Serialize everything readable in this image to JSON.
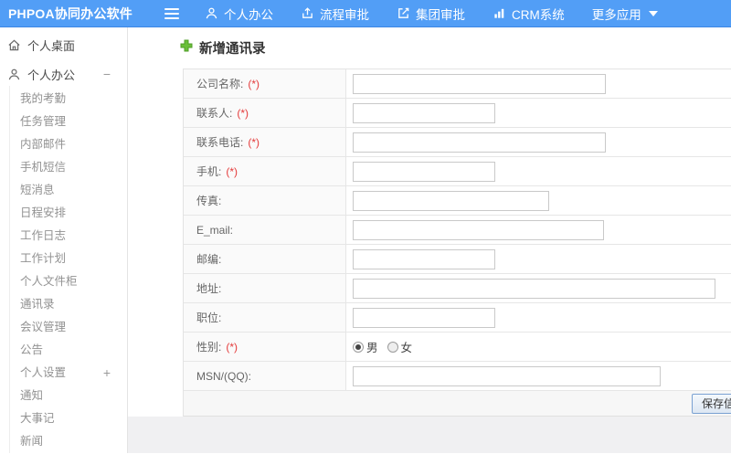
{
  "colors": {
    "header_blue": "#529ef6",
    "required_red": "#e43b3b",
    "plus_green": "#6abf3a"
  },
  "header": {
    "logo": "PHPOA协同办公软件",
    "nav": [
      {
        "label": "个人办公",
        "icon": "user-icon"
      },
      {
        "label": "流程审批",
        "icon": "flow-approval-icon"
      },
      {
        "label": "集团审批",
        "icon": "edit-square-icon"
      },
      {
        "label": "CRM系统",
        "icon": "bar-chart-icon"
      },
      {
        "label": "更多应用",
        "icon": "caret-down-icon"
      }
    ]
  },
  "sidebar": {
    "desktop": {
      "label": "个人桌面"
    },
    "office": {
      "label": "个人办公",
      "toggle": "−"
    },
    "office_items": [
      "我的考勤",
      "任务管理",
      "内部邮件",
      "手机短信",
      "短消息",
      "日程安排",
      "工作日志",
      "工作计划",
      "个人文件柜",
      "通讯录",
      "会议管理",
      "公告"
    ],
    "settings": {
      "label": "个人设置",
      "toggle": "+"
    },
    "more_items": [
      "通知",
      "大事记",
      "新闻"
    ]
  },
  "form": {
    "title": "新增通讯录",
    "rows": [
      {
        "label": "公司名称:",
        "required": "(*)"
      },
      {
        "label": "联系人:",
        "required": "(*)"
      },
      {
        "label": "联系电话:",
        "required": "(*)"
      },
      {
        "label": "手机:",
        "required": "(*)"
      },
      {
        "label": "传真:",
        "required": ""
      },
      {
        "label": "E_mail:",
        "required": ""
      },
      {
        "label": "邮编:",
        "required": ""
      },
      {
        "label": "地址:",
        "required": ""
      },
      {
        "label": "职位:",
        "required": ""
      },
      {
        "label": "性别:",
        "required": "(*)"
      },
      {
        "label": "MSN/(QQ):",
        "required": ""
      }
    ],
    "inputs": [
      {
        "value": "",
        "placeholder": ""
      }
    ],
    "gender": {
      "male": "男",
      "female": "女",
      "selected": "男"
    },
    "save_button": "保存信息"
  }
}
